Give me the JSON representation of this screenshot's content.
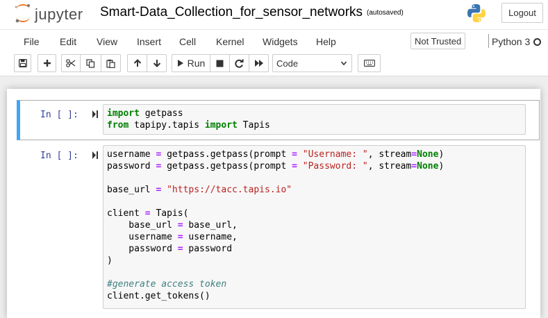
{
  "header": {
    "logo_text": "jupyter",
    "notebook_title": "Smart-Data_Collection_for_sensor_networks",
    "autosave_status": "(autosaved)",
    "logout_label": "Logout"
  },
  "menubar": {
    "items": [
      "File",
      "Edit",
      "View",
      "Insert",
      "Cell",
      "Kernel",
      "Widgets",
      "Help"
    ],
    "trust_status": "Not Trusted",
    "kernel_name": "Python 3"
  },
  "toolbar": {
    "run_label": "Run",
    "cell_type": "Code",
    "icons": [
      "save-icon",
      "plus-icon",
      "cut-icon",
      "copy-icon",
      "paste-icon",
      "arrow-up-icon",
      "arrow-down-icon",
      "run-icon",
      "stop-icon",
      "restart-icon",
      "fast-forward-icon",
      "keyboard-icon"
    ]
  },
  "cells": [
    {
      "prompt": "In [ ]:",
      "code": [
        "import getpass",
        "from tapipy.tapis import Tapis"
      ]
    },
    {
      "prompt": "In [ ]:",
      "code": [
        "username = getpass.getpass(prompt = \"Username: \", stream=None)",
        "password = getpass.getpass(prompt = \"Password: \", stream=None)",
        "",
        "base_url = \"https://tacc.tapis.io\"",
        "",
        "client = Tapis(",
        "    base_url = base_url,",
        "    username = username,",
        "    password = password",
        ")",
        "",
        "#generate access token",
        "client.get_tokens()"
      ]
    }
  ],
  "colors": {
    "keyword": "#008000",
    "string": "#ba2121",
    "operator": "#aa22ff",
    "comment": "#408080",
    "prompt": "#303f9f",
    "selected_cell_border": "#42a5f5",
    "jupyter_orange": "#f37726"
  }
}
